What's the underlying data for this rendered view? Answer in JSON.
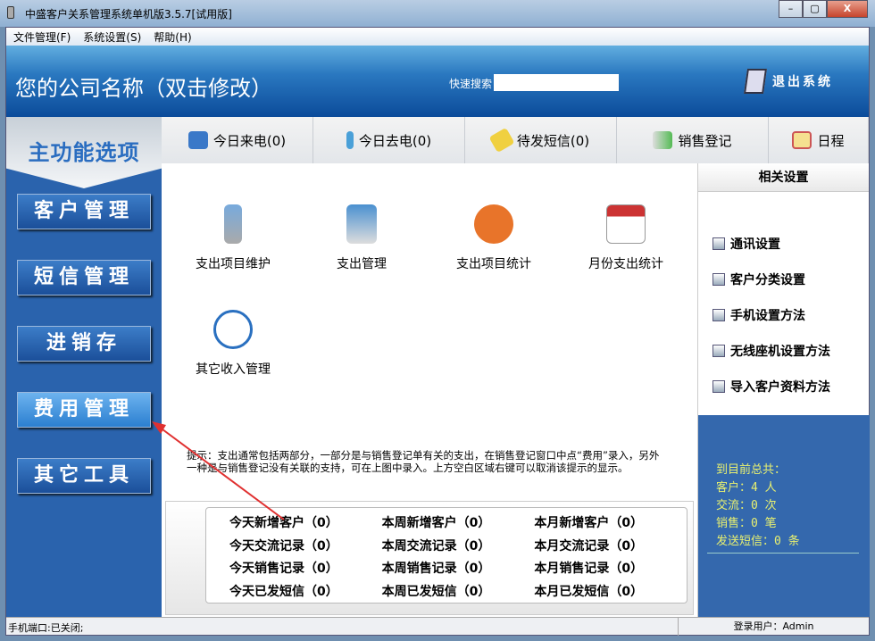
{
  "window": {
    "title": "中盛客户关系管理系统单机版3.5.7[试用版]",
    "minimize": "–",
    "maximize": "▢",
    "close": "X"
  },
  "menu": [
    "文件管理(F)",
    "系统设置(S)",
    "帮助(H)"
  ],
  "header": {
    "company": "您的公司名称（双击修改）",
    "search_label": "快速搜索",
    "search_value": "",
    "exit": "退出系统"
  },
  "sidebar": {
    "title": "主功能选项",
    "items": [
      "客户管理",
      "短信管理",
      "进销存",
      "费用管理",
      "其它工具"
    ],
    "active": "费用管理"
  },
  "tabs": [
    {
      "label": "今日来电(0)",
      "icon": "phone-in-icon"
    },
    {
      "label": "今日去电(0)",
      "icon": "phone-out-icon"
    },
    {
      "label": "待发短信(0)",
      "icon": "envelope-icon"
    },
    {
      "label": "销售登记",
      "icon": "sales-icon"
    },
    {
      "label": "日程",
      "icon": "calendar-clock-icon"
    }
  ],
  "functions": [
    "支出项目维护",
    "支出管理",
    "支出项目统计",
    "月份支出统计",
    "其它收入管理"
  ],
  "tip": "提示：支出通常包括两部分，一部分是与销售登记单有关的支出，在销售登记窗口中点“费用”录入，另外一种是与销售登记没有关联的支持，可在上图中录入。上方空白区域右键可以取消该提示的显示。",
  "stats": [
    "今天新增客户（0）",
    "本周新增客户（0）",
    "本月新增客户（0）",
    "今天交流记录（0）",
    "本周交流记录（0）",
    "本月交流记录（0）",
    "今天销售记录（0）",
    "本周销售记录（0）",
    "本月销售记录（0）",
    "今天已发短信（0）",
    "本周已发短信（0）",
    "本月已发短信（0）"
  ],
  "settings": {
    "title": "相关设置",
    "links": [
      "通讯设置",
      "客户分类设置",
      "手机设置方法",
      "无线座机设置方法",
      "导入客户资料方法"
    ]
  },
  "totals": {
    "heading": "到目前总共：",
    "lines": [
      "客户：4 人",
      "交流：0 次",
      "销售：0 笔",
      "发送短信：0 条"
    ]
  },
  "status": {
    "port": "手机端口:已关闭;",
    "user": "登录用户：Admin"
  },
  "colors": {
    "sidebar": "#2a63ad",
    "totals_text": "#e8f070",
    "arrow": "#e03030"
  }
}
